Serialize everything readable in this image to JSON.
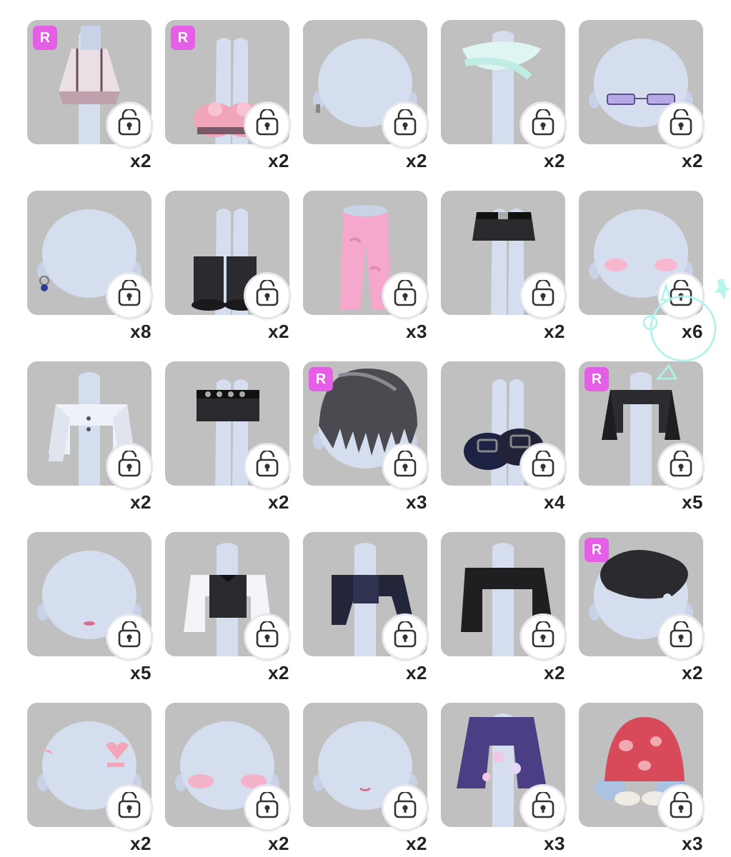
{
  "accent_colors": {
    "rare_badge": "#e45fe6",
    "tile": "#c0c0c0",
    "head": "#d4deef"
  },
  "items": [
    {
      "art": "dress",
      "rare": true,
      "quantity": "x2"
    },
    {
      "art": "sneakers",
      "rare": true,
      "quantity": "x2"
    },
    {
      "art": "earring-small",
      "rare": false,
      "quantity": "x2"
    },
    {
      "art": "bandage",
      "rare": false,
      "quantity": "x2"
    },
    {
      "art": "glasses",
      "rare": false,
      "quantity": "x2"
    },
    {
      "art": "earring-blue",
      "rare": false,
      "quantity": "x8"
    },
    {
      "art": "boots",
      "rare": false,
      "quantity": "x2"
    },
    {
      "art": "pink-pants",
      "rare": false,
      "quantity": "x3"
    },
    {
      "art": "black-skirt",
      "rare": false,
      "quantity": "x2"
    },
    {
      "art": "blush",
      "rare": false,
      "quantity": "x6"
    },
    {
      "art": "white-jacket",
      "rare": false,
      "quantity": "x2"
    },
    {
      "art": "studded-skirt",
      "rare": false,
      "quantity": "x2"
    },
    {
      "art": "hair",
      "rare": true,
      "quantity": "x3"
    },
    {
      "art": "loafers",
      "rare": false,
      "quantity": "x4"
    },
    {
      "art": "black-coat",
      "rare": true,
      "quantity": "x5"
    },
    {
      "art": "lips",
      "rare": false,
      "quantity": "x5"
    },
    {
      "art": "tuxedo",
      "rare": false,
      "quantity": "x2"
    },
    {
      "art": "dark-top",
      "rare": false,
      "quantity": "x2"
    },
    {
      "art": "black-jacket",
      "rare": false,
      "quantity": "x2"
    },
    {
      "art": "beret",
      "rare": true,
      "quantity": "x2"
    },
    {
      "art": "stickers",
      "rare": false,
      "quantity": "x2"
    },
    {
      "art": "cheek-blush",
      "rare": false,
      "quantity": "x2"
    },
    {
      "art": "small-mouth",
      "rare": false,
      "quantity": "x2"
    },
    {
      "art": "floral-robe",
      "rare": false,
      "quantity": "x3"
    },
    {
      "art": "mushroom-hat",
      "rare": false,
      "quantity": "x3"
    }
  ],
  "labels": {
    "rare": "R"
  },
  "icons": {
    "lock": "unlocked-padlock-icon"
  }
}
